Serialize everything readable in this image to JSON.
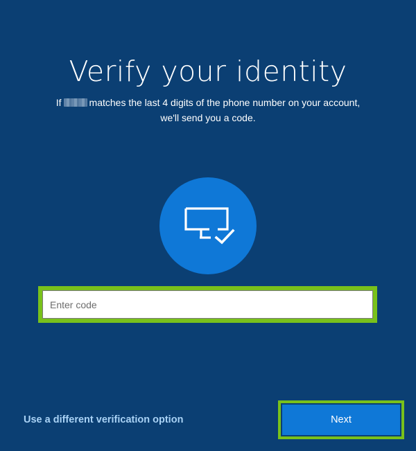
{
  "heading": "Verify your identity",
  "subtitle": {
    "line1_before": "If",
    "line1_after": "matches the last 4 digits of the phone number on your account,",
    "line2": "we'll send you a code."
  },
  "icon": "computer-check-icon",
  "code_field": {
    "value": "",
    "placeholder": "Enter code"
  },
  "actions": {
    "alternate_option": "Use a different verification option",
    "next": "Next"
  },
  "colors": {
    "background": "#0b3f73",
    "accent": "#0f78d7",
    "highlight": "#79c11b",
    "link": "#a9d2f5"
  }
}
